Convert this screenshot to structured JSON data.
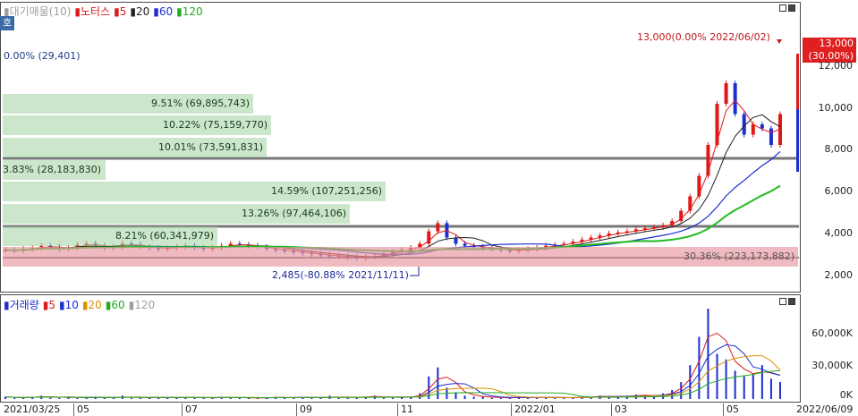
{
  "price_panel": {
    "legend": [
      {
        "text": "대기매물(10)",
        "color": "#9e9e9e"
      },
      {
        "text": "노터스",
        "color": "#d81b1b"
      },
      {
        "text": "5",
        "color": "#d81b1b"
      },
      {
        "text": "20",
        "color": "#222222"
      },
      {
        "text": "60",
        "color": "#1e2fd0"
      },
      {
        "text": "120",
        "color": "#22aa22"
      }
    ],
    "corner_label": "호",
    "top_ratio": "0.00% (29,401)",
    "high_note": "13,000(0.00% 2022/06/02)",
    "low_note": "2,485(-80.88% 2021/11/11)",
    "current_badge_price": "13,000",
    "current_badge_pct": "(30.00%)",
    "y_ticks": [
      "12,000",
      "10,000",
      "8,000",
      "6,000",
      "4,000",
      "2,000"
    ],
    "supply_bars": [
      {
        "label": "9.51% (69,895,743)",
        "highlight": false
      },
      {
        "label": "10.22% (75,159,770)",
        "highlight": false
      },
      {
        "label": "10.01% (73,591,831)",
        "highlight": false
      },
      {
        "label": "3.83% (28,183,830)",
        "highlight": false
      },
      {
        "label": "14.59% (107,251,256)",
        "highlight": false
      },
      {
        "label": "13.26% (97,464,106)",
        "highlight": false
      },
      {
        "label": "8.21% (60,341,979)",
        "highlight": false
      },
      {
        "label": "30.36% (223,173,882)",
        "highlight": true
      }
    ]
  },
  "volume_panel": {
    "legend": [
      {
        "text": "거래량",
        "color": "#1e2fd0"
      },
      {
        "text": "5",
        "color": "#d81b1b"
      },
      {
        "text": "10",
        "color": "#1e2fd0"
      },
      {
        "text": "20",
        "color": "#e09000"
      },
      {
        "text": "60",
        "color": "#22aa22"
      },
      {
        "text": "120",
        "color": "#9e9e9e"
      }
    ],
    "y_ticks": [
      "60,000K",
      "30,000K",
      "0K"
    ]
  },
  "x_axis": [
    "2021/03/25",
    "05",
    "07",
    "09",
    "11",
    "2022/01",
    "03",
    "05",
    "2022/06/09"
  ],
  "chart_data": {
    "type": "candlestick",
    "price_range": [
      1500,
      13800
    ],
    "volume_range": [
      0,
      80000
    ],
    "price_series": [
      2.9,
      2.85,
      2.95,
      3.0,
      3.1,
      3.05,
      2.95,
      3.0,
      3.15,
      3.2,
      3.1,
      3.0,
      3.05,
      3.2,
      3.15,
      3.05,
      3.0,
      2.95,
      3.0,
      3.05,
      3.1,
      3.0,
      2.95,
      3.0,
      3.1,
      3.2,
      3.15,
      3.1,
      3.05,
      2.95,
      2.9,
      2.85,
      2.8,
      2.75,
      2.7,
      2.65,
      2.6,
      2.6,
      2.55,
      2.5,
      2.55,
      2.6,
      2.7,
      2.8,
      2.9,
      3.0,
      3.2,
      3.8,
      4.2,
      3.5,
      3.2,
      3.1,
      3.05,
      3.0,
      2.95,
      2.9,
      2.85,
      2.9,
      2.95,
      3.0,
      3.1,
      3.15,
      3.2,
      3.3,
      3.4,
      3.5,
      3.6,
      3.7,
      3.75,
      3.8,
      3.9,
      3.95,
      4.0,
      4.1,
      4.3,
      4.8,
      5.5,
      6.5,
      8.0,
      10.0,
      11.0,
      9.5,
      8.5,
      9.0,
      8.8,
      8.0,
      9.5
    ],
    "volume_series": [
      2,
      1,
      1,
      2,
      3,
      1,
      1,
      2,
      1,
      1,
      2,
      1,
      1,
      3,
      1,
      1,
      1,
      2,
      1,
      1,
      2,
      1,
      1,
      1,
      2,
      1,
      1,
      1,
      1,
      1,
      2,
      1,
      1,
      2,
      1,
      1,
      3,
      1,
      1,
      2,
      2,
      3,
      1,
      1,
      2,
      2,
      5,
      20,
      28,
      10,
      6,
      3,
      2,
      2,
      1,
      1,
      1,
      2,
      1,
      1,
      2,
      1,
      1,
      1,
      2,
      2,
      3,
      2,
      2,
      3,
      4,
      3,
      2,
      5,
      8,
      15,
      30,
      55,
      80,
      40,
      35,
      25,
      20,
      22,
      30,
      18,
      15
    ]
  }
}
